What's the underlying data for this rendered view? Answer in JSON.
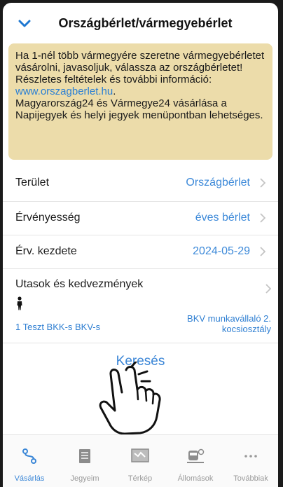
{
  "header": {
    "title": "Országbérlet/vármegyebérlet",
    "collapse_icon": "chevron-down-icon"
  },
  "notice": {
    "line1": "Ha 1-nél több vármegyére szeretne vármegyebérletet vásárolni, javasoljuk, válassza az országbérletet!",
    "line2": "Részletes feltételek és további információ:",
    "link": "www.orszagberlet.hu",
    "link_suffix": ".",
    "line3": "Magyarország24 és Vármegye24 vásárlása a Napijegyek és helyi jegyek menüpontban lehetséges."
  },
  "form": {
    "area": {
      "label": "Terület",
      "value": "Országbérlet"
    },
    "validity": {
      "label": "Érvényesség",
      "value": "éves bérlet"
    },
    "start": {
      "label": "Érv. kezdete",
      "value": "2024-05-29"
    },
    "passengers": {
      "label": "Utasok és kedvezmények",
      "person_icon": "person-icon",
      "passenger": "1 Teszt BKK-s BKV-s",
      "discount": "BKV munkavállaló 2. kocsiosztály"
    }
  },
  "search_label": "Keresés",
  "tabbar": {
    "items": [
      {
        "label": "Vásárlás",
        "icon": "route-icon",
        "active": true
      },
      {
        "label": "Jegyeim",
        "icon": "ticket-icon",
        "active": false
      },
      {
        "label": "Térkép",
        "icon": "map-icon",
        "active": false
      },
      {
        "label": "Állomások",
        "icon": "station-icon",
        "active": false
      },
      {
        "label": "Továbbiak",
        "icon": "more-icon",
        "active": false
      }
    ]
  },
  "colors": {
    "accent": "#3b87d7",
    "notice_bg": "#ecdcaa"
  }
}
